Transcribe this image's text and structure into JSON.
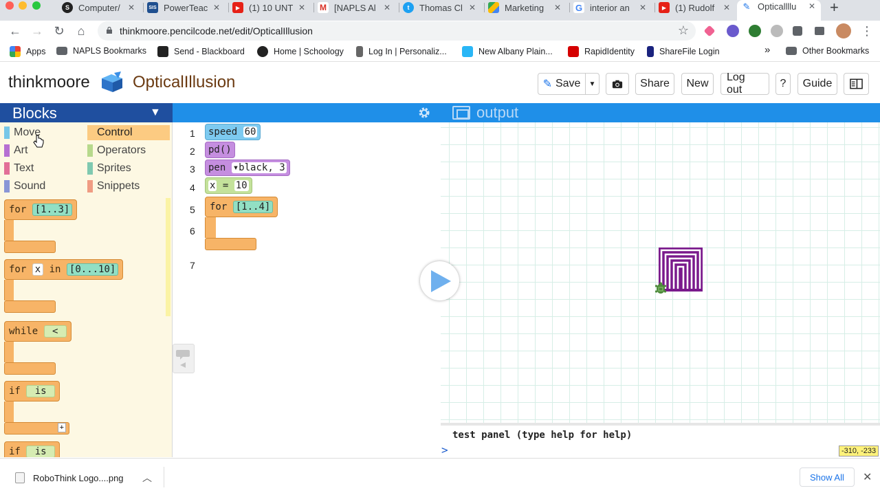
{
  "browser": {
    "tabs": [
      {
        "label": "Computer/",
        "icon": "S",
        "color": "#222"
      },
      {
        "label": "PowerTeac",
        "icon": "SIS",
        "color": "#1f4f8f"
      },
      {
        "label": "(1) 10 UNT",
        "icon": "youtube",
        "color": "#e62117"
      },
      {
        "label": "[NAPLS Al",
        "icon": "M",
        "color": "#d93025"
      },
      {
        "label": "Thomas Cl",
        "icon": "bird",
        "color": "#1da1f2"
      },
      {
        "label": "Marketing",
        "icon": "drive",
        "color": "#34a853"
      },
      {
        "label": "interior an",
        "icon": "G",
        "color": "#4285f4"
      },
      {
        "label": "(1) Rudolf",
        "icon": "youtube",
        "color": "#e62117"
      },
      {
        "label": "Opticallllu",
        "icon": "pencil",
        "color": "#1a73e8"
      }
    ],
    "url": "thinkmoore.pencilcode.net/edit/OpticalIllusion",
    "bookmarks": [
      {
        "label": "Apps"
      },
      {
        "label": "NAPLS Bookmarks"
      },
      {
        "label": "Send - Blackboard"
      },
      {
        "label": "Home | Schoology"
      },
      {
        "label": "Log In | Personaliz..."
      },
      {
        "label": "New Albany Plain..."
      },
      {
        "label": "RapidIdentity"
      },
      {
        "label": "ShareFile Login"
      }
    ],
    "more_bookmarks": "»",
    "other_bookmarks": "Other Bookmarks"
  },
  "header": {
    "brand": "thinkmoore",
    "project": "OpticalIllusion",
    "buttons": {
      "save": "Save",
      "share": "Share",
      "new": "New",
      "logout": "Log out",
      "help": "?",
      "guide": "Guide"
    }
  },
  "palette": {
    "title": "Blocks",
    "categories": [
      {
        "label": "Move",
        "color": "#76c7e8"
      },
      {
        "label": "Art",
        "color": "#b66fd2"
      },
      {
        "label": "Text",
        "color": "#e26f97"
      },
      {
        "label": "Sound",
        "color": "#8a96d6"
      },
      {
        "label": "Control",
        "color": "#fccb82"
      },
      {
        "label": "Operators",
        "color": "#b7d98c"
      },
      {
        "label": "Sprites",
        "color": "#7fc9b0"
      },
      {
        "label": "Snippets",
        "color": "#f09c83"
      }
    ],
    "selected": "Control",
    "blocks": {
      "for1_kw": "for",
      "for1_range": "[1..3]",
      "for2_kw": "for",
      "for2_var": "x",
      "for2_in": "in",
      "for2_range": "[0...10]",
      "while_kw": "while",
      "while_op": "<",
      "if1_kw": "if",
      "if1_is": "is",
      "if1_plus": "+",
      "if2_kw": "if",
      "if2_is": "is"
    }
  },
  "editor": {
    "line_numbers": [
      "1",
      "2",
      "3",
      "4",
      "5",
      "6",
      "7"
    ],
    "code": {
      "speed_kw": "speed",
      "speed_val": "60",
      "pd": "pd()",
      "pen_kw": "pen",
      "pen_color": "▾black",
      "pen_sep": ",",
      "pen_width": "3",
      "assign_var": "x",
      "assign_eq": "=",
      "assign_val": "10",
      "for_kw": "for",
      "for_range": "[1..4]"
    }
  },
  "output": {
    "title": "output",
    "test_panel": "test panel (type help for help)",
    "prompt": ">",
    "coordinates": "-310, -233"
  },
  "downloads": {
    "file": "RoboThink Logo....png",
    "show_all": "Show All"
  }
}
